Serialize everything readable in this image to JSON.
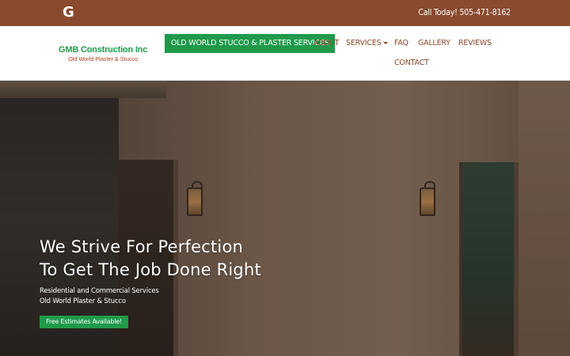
{
  "topbar": {
    "social_icon": "google-icon",
    "phone_text": "Call Today! 505-471-8162"
  },
  "brand": {
    "name": "GMB Construction Inc",
    "tagline": "Old World Plaster & Stucco"
  },
  "nav": {
    "items": [
      {
        "label": "OLD WORLD STUCCO & PLASTER SERVICES"
      },
      {
        "label": "ABOUT"
      },
      {
        "label": "SERVICES"
      },
      {
        "label": "FAQ"
      },
      {
        "label": "GALLERY"
      },
      {
        "label": "REVIEWS"
      },
      {
        "label": "CONTACT"
      }
    ]
  },
  "hero": {
    "title_line1": "We Strive For Perfection",
    "title_line2": "To Get The Job Done Right",
    "sub_line1": "Residential and Commercial Services",
    "sub_line2": "Old World Plaster & Stucco",
    "cta_label": "Free Estimates Available!"
  },
  "colors": {
    "topbar": "#8a4a2e",
    "brand_green": "#1f9a4a",
    "nav_text": "#8a4a2e"
  }
}
